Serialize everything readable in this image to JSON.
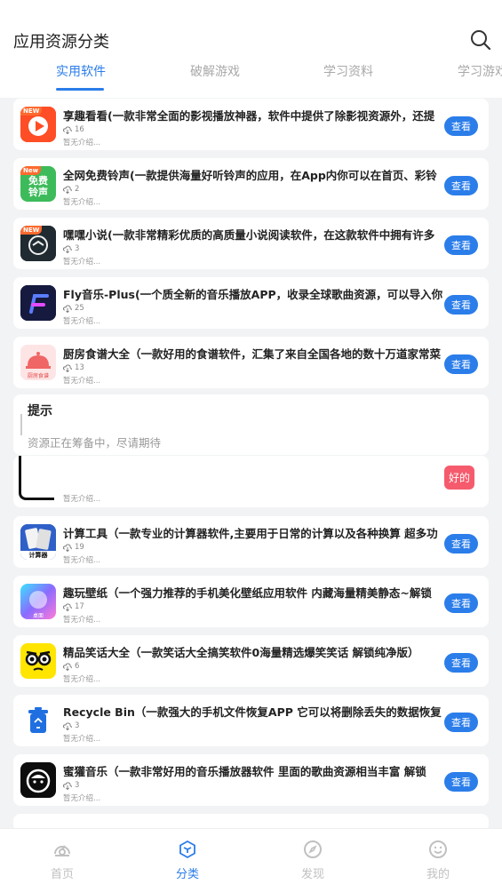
{
  "header": {
    "title": "应用资源分类"
  },
  "tabs": [
    {
      "label": "实用软件",
      "active": true
    },
    {
      "label": "破解游戏",
      "active": false
    },
    {
      "label": "学习资料",
      "active": false
    },
    {
      "label": "学习游戏",
      "active": false
    }
  ],
  "view_label": "查看",
  "apps": [
    {
      "title": "享趣看看(一款非常全面的影视播放神器，软件中提供了除影视资源外，还提",
      "downloads": "16",
      "desc": "暂无介绍...",
      "icon": "play-icon",
      "new_tag": "NEW"
    },
    {
      "title": "全网免费铃声(一款提供海量好听铃声的应用，在App内你可以在首页、彩铃",
      "downloads": "2",
      "desc": "暂无介绍...",
      "icon": "ringtone-icon",
      "new_tag": "New",
      "icon_text": "免费\n铃声"
    },
    {
      "title": "嘿嘿小说(一款非常精彩优质的高质量小说阅读软件，在这款软件中拥有许多",
      "downloads": "3",
      "desc": "暂无介绍...",
      "icon": "book-icon",
      "new_tag": "NEW"
    },
    {
      "title": "Fly音乐-Plus(一个质全新的音乐播放APP，收录全球歌曲资源，可以导入你",
      "downloads": "25",
      "desc": "暂无介绍...",
      "icon": "music-f-icon"
    },
    {
      "title": "厨房食谱大全（一款好用的食谱软件，汇集了来自全国各地的数十万道家常菜",
      "downloads": "13",
      "desc": "暂无介绍...",
      "icon": "cooking-icon",
      "icon_text": "厨房食谱"
    },
    {
      "title": "计算工具（一款专业的计算器软件,主要用于日常的计算以及各种换算 超多功",
      "downloads": "19",
      "desc": "暂无介绍...",
      "icon": "calculator-icon",
      "icon_text": "计算器"
    },
    {
      "title": "趣玩壁纸（一个强力推荐的手机美化壁纸应用软件 内藏海量精美静态~解锁",
      "downloads": "17",
      "desc": "暂无介绍...",
      "icon": "wallpaper-icon",
      "icon_text": "桌面"
    },
    {
      "title": "精品笑话大全（一款笑话大全搞笑软件0海量精选爆笑笑话 解锁纯净版）",
      "downloads": "6",
      "desc": "暂无介绍...",
      "icon": "joke-face-icon"
    },
    {
      "title": "Recycle Bin（一款强大的手机文件恢复APP 它可以将删除丢失的数据恢复",
      "downloads": "3",
      "desc": "暂无介绍...",
      "icon": "recycle-bin-icon"
    },
    {
      "title": "蜜獾音乐（一款非常好用的音乐播放器软件 里面的歌曲资源相当丰富 解锁",
      "downloads": "3",
      "desc": "暂无介绍...",
      "icon": "honey-badger-icon"
    }
  ],
  "hidden_row": {
    "desc": "暂无介绍..."
  },
  "dialog": {
    "title": "提示",
    "message": "资源正在筹备中，尽请期待",
    "ok_label": "好的"
  },
  "nav": [
    {
      "label": "首页",
      "icon": "home-icon",
      "active": false
    },
    {
      "label": "分类",
      "icon": "category-cube-icon",
      "active": true
    },
    {
      "label": "发现",
      "icon": "compass-icon",
      "active": false
    },
    {
      "label": "我的",
      "icon": "smile-icon",
      "active": false
    }
  ]
}
